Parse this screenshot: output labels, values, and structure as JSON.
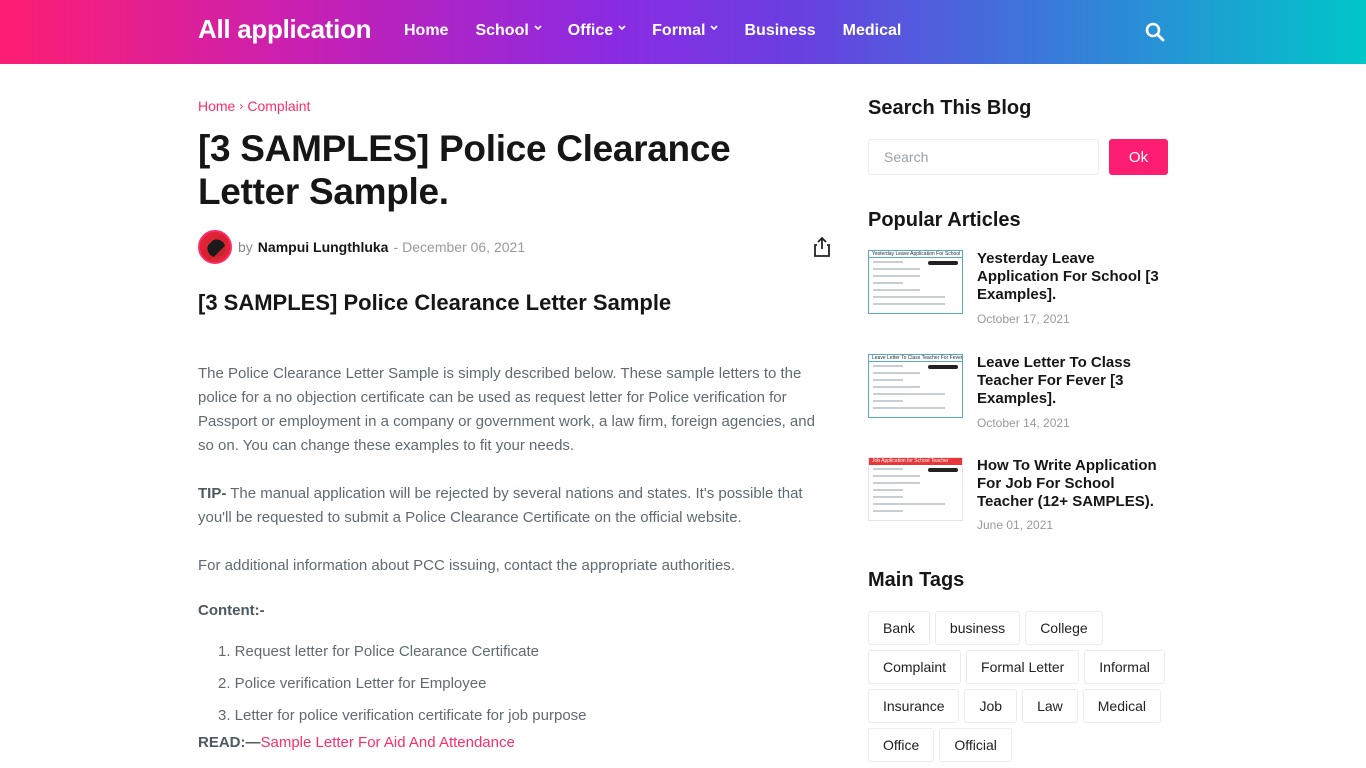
{
  "header": {
    "brand": "All application",
    "nav": [
      {
        "label": "Home",
        "has_dropdown": false
      },
      {
        "label": "School",
        "has_dropdown": true
      },
      {
        "label": "Office",
        "has_dropdown": true
      },
      {
        "label": "Formal",
        "has_dropdown": true
      },
      {
        "label": "Business",
        "has_dropdown": false
      },
      {
        "label": "Medical",
        "has_dropdown": false
      }
    ],
    "search_icon": "search-icon",
    "gradient_colors": [
      "#fe1e71",
      "#8a2be2",
      "#00c6c8"
    ]
  },
  "breadcrumb": {
    "home": "Home",
    "separator": "›",
    "current": "Complaint"
  },
  "post": {
    "title": "[3 SAMPLES] Police Clearance Letter Sample.",
    "meta": {
      "by": "by",
      "author": "Nampui Lungthluka",
      "dash": "-",
      "date": "December 06, 2021",
      "share_icon": "share-icon"
    },
    "subtitle": "[3 SAMPLES] Police Clearance Letter Sample",
    "paragraph_1": "The Police Clearance Letter Sample is simply described below. These sample letters to the police for a no objection certificate can be used as request letter for Police verification for Passport or employment in a company or government work, a law firm, foreign agencies, and so on. You can change these examples to fit your needs.",
    "tip_label": "TIP-",
    "tip_text": " The manual application will be rejected by several nations and states. It's possible that you'll be requested to submit a Police Clearance Certificate on the official website.",
    "paragraph_3": "For additional information about PCC issuing, contact the appropriate authorities.",
    "content_label": "Content:-",
    "toc": [
      "1. Request letter for Police Clearance Certificate",
      "2. Police verification Letter for Employee",
      "3. Letter for police verification certificate for job purpose"
    ],
    "read_label": "READ:—",
    "read_link": "Sample Letter For Aid And Attendance"
  },
  "sidebar": {
    "search_title": "Search This Blog",
    "search_placeholder": "Search",
    "search_value": "",
    "search_button": "Ok",
    "popular_title": "Popular Articles",
    "popular": [
      {
        "title": "Yesterday Leave Application For School [3 Examples].",
        "date": "October 17, 2021",
        "thumb_caption": "Yesterday Leave Application For School"
      },
      {
        "title": "Leave Letter To Class Teacher For Fever [3 Examples].",
        "date": "October 14, 2021",
        "thumb_caption": "Leave Letter To Class Teacher For Fever"
      },
      {
        "title": "How To Write Application For Job For School Teacher (12+ SAMPLES).",
        "date": "June 01, 2021",
        "thumb_caption": "Job Application for School Teacher"
      }
    ],
    "tags_title": "Main Tags",
    "tags": [
      "Bank",
      "business",
      "College",
      "Complaint",
      "Formal Letter",
      "Informal",
      "Insurance",
      "Job",
      "Law",
      "Medical",
      "Office",
      "Official"
    ]
  },
  "colors": {
    "accent": "#fe2c6c",
    "button": "#fe1e71",
    "text_dark": "#161617",
    "text_body": "#5f6a73",
    "meta_gray": "#9a9a9a"
  }
}
